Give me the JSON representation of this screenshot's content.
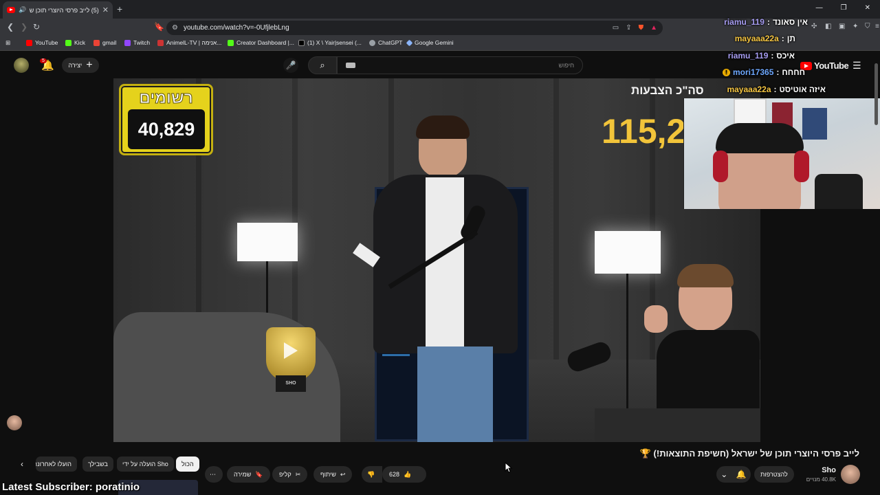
{
  "browser": {
    "tab": {
      "title": "(5) לייב פרסי היוצרי תוכן של"
    },
    "address": "youtube.com/watch?v=-0UfjlebLng",
    "bookmarks": [
      {
        "label": "YouTube",
        "color": "#ff0000"
      },
      {
        "label": "Kick",
        "color": "#53fc18"
      },
      {
        "label": "gmail",
        "color": "#ea4335"
      },
      {
        "label": "Twitch",
        "color": "#9146ff"
      },
      {
        "label": "AnimelL-TV | אנימה...",
        "color": "#c33"
      },
      {
        "label": "Creator Dashboard |...",
        "color": "#53fc18"
      },
      {
        "label": "(1) X \\ Yair|sensei (...",
        "color": "#000000"
      },
      {
        "label": "ChatGPT",
        "color": "#9aa0a6"
      },
      {
        "label": "Google Gemini",
        "color": "#8ab4f8"
      }
    ]
  },
  "youtube": {
    "notifications_count": "5",
    "create_label": "יצירה",
    "search_placeholder": "חיפוש",
    "logo_text": "YouTube"
  },
  "chat": [
    {
      "user": "riamu_119",
      "message": "אין סאונד",
      "color": "#a79df2"
    },
    {
      "user": "",
      "message": "תן",
      "color": "#a79df2"
    },
    {
      "user": "mayaaa22a",
      "message": "",
      "color": "#f5c542"
    },
    {
      "user": "riamu_119",
      "message": "איכס",
      "color": "#a79df2"
    },
    {
      "user": "mori17365",
      "message": "חחחח",
      "color": "#6ea8ff"
    },
    {
      "user": "mayaaa22a",
      "message": "איזה אוטיסט",
      "color": "#f5c542"
    }
  ],
  "overlay": {
    "subs_label": "רשומים",
    "subs_count": "40,829",
    "goal_label": "סה\"כ הצבעות",
    "goal_value": "115,2"
  },
  "trophy_label": "SHO",
  "video_title": "לייב פרסי היוצרי תוכן של ישראל (חשיפת התוצאות!) 🏆",
  "channel": {
    "name": "Sho",
    "subscribers": "40.8K מנויים",
    "join_label": "להצטרפות"
  },
  "actions": {
    "likes": "628",
    "share": "שיתוף",
    "clip": "קליפ",
    "save": "שמירה"
  },
  "chips": [
    "הכול",
    "הועלה על ידי Sho",
    "בשבילך",
    "הועלו לאחרונה"
  ],
  "stream_overlay": {
    "latest_subscriber": "Latest Subscriber: poratinio"
  }
}
